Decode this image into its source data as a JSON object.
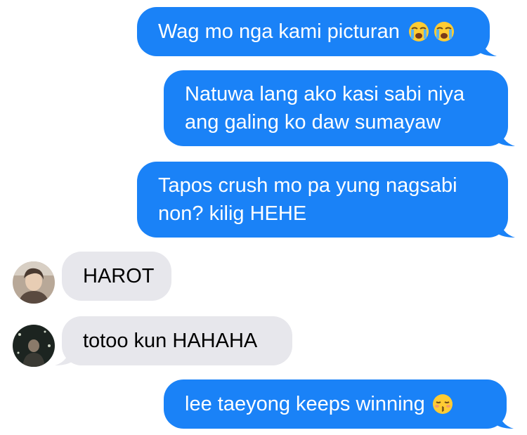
{
  "conversation": {
    "messages": [
      {
        "direction": "sent",
        "text": "Wag mo nga kami picturan",
        "emojis": [
          "loudly-crying-face",
          "loudly-crying-face"
        ]
      },
      {
        "direction": "sent",
        "lines": [
          "Natuwa lang ako kasi sabi niya",
          "ang galing ko daw sumayaw"
        ]
      },
      {
        "direction": "sent",
        "lines": [
          "Tapos crush mo pa yung nagsabi",
          "non? kilig HEHE"
        ]
      },
      {
        "direction": "received",
        "text": "HAROT",
        "avatar": "contact-photo-1"
      },
      {
        "direction": "received",
        "text": "totoo kun HAHAHA",
        "avatar": "contact-photo-2"
      },
      {
        "direction": "sent",
        "text": "lee taeyong keeps winning",
        "emojis": [
          "kissing-face-with-closed-eyes"
        ]
      }
    ]
  },
  "colors": {
    "sent_bubble": "#1a82f7",
    "received_bubble": "#e7e7ec",
    "sent_text": "#ffffff",
    "received_text": "#000000"
  }
}
